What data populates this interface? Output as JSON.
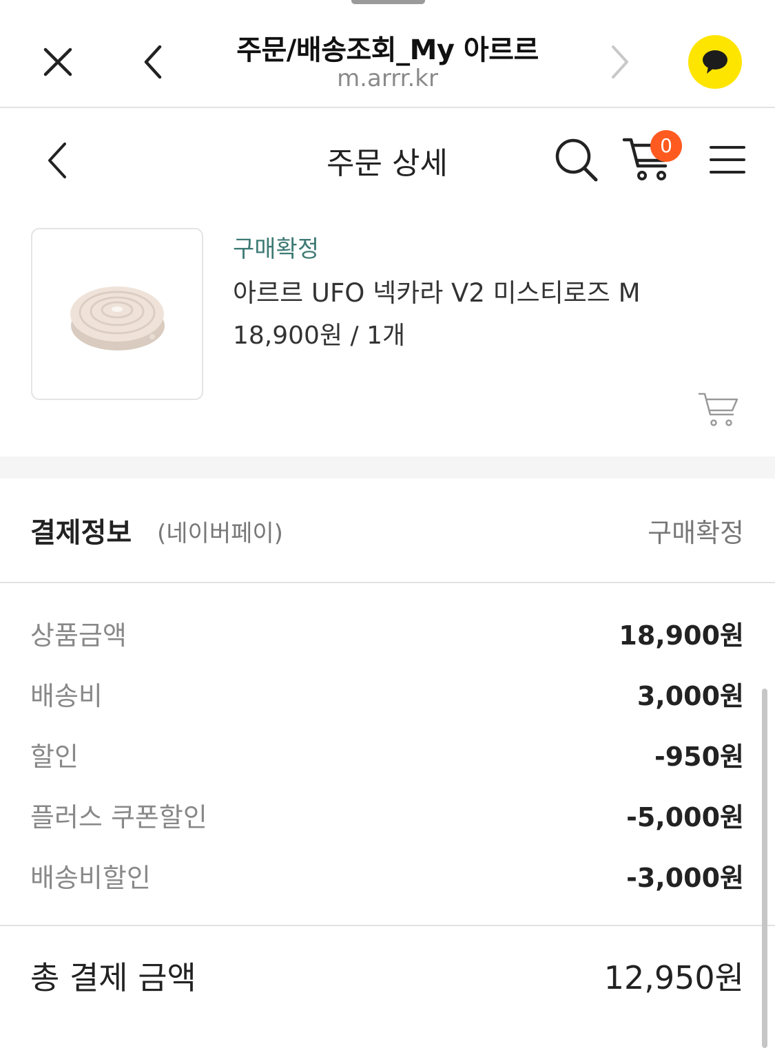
{
  "browser": {
    "title": "주문/배송조회_My 아르르",
    "url": "m.arrr.kr"
  },
  "header": {
    "title": "주문 상세",
    "cart_count": "0"
  },
  "product": {
    "status": "구매확정",
    "name": "아르르 UFO 넥카라 V2 미스티로즈 M",
    "price_qty": "18,900원 / 1개"
  },
  "payment": {
    "title": "결제정보",
    "method": "(네이버페이)",
    "status": "구매확정",
    "rows": [
      {
        "label": "상품금액",
        "value": "18,900원"
      },
      {
        "label": "배송비",
        "value": "3,000원"
      },
      {
        "label": "할인",
        "value": "-950원"
      },
      {
        "label": "플러스 쿠폰할인",
        "value": "-5,000원"
      },
      {
        "label": "배송비할인",
        "value": "-3,000원"
      }
    ],
    "total_label": "총 결제 금액",
    "total_value": "12,950원"
  },
  "colors": {
    "status_green": "#3d7a74",
    "kakao_yellow": "#fee500",
    "badge_orange": "#ff5a1f"
  },
  "icons": [
    "close-icon",
    "back-icon",
    "forward-icon",
    "kakao-chat-icon",
    "search-icon",
    "cart-icon",
    "menu-icon",
    "add-to-cart-icon"
  ]
}
